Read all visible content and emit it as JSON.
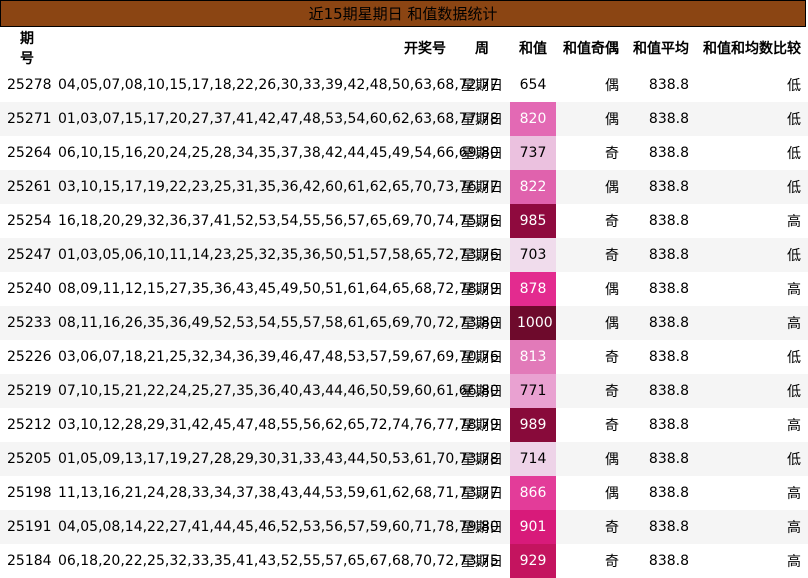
{
  "title": "近15期星期日 和值数据统计",
  "headers": {
    "issue": "期号",
    "numbers": "开奖号",
    "weekday": "周",
    "sum": "和值",
    "sum_oe": "和值奇偶",
    "sum_avg": "和值平均",
    "sum_cmp": "和值和均数比较"
  },
  "rows": [
    {
      "issue": "25278",
      "numbers": "04,05,07,08,10,15,17,18,22,26,30,33,39,42,48,50,63,68,72,77",
      "weekday": "星期日",
      "sum": "654",
      "oe": "偶",
      "avg": "838.8",
      "cmp": "低",
      "color": "#ffffff",
      "textColor": "#000000"
    },
    {
      "issue": "25271",
      "numbers": "01,03,07,15,17,20,27,37,41,42,47,48,53,54,60,62,63,68,77,78",
      "weekday": "星期日",
      "sum": "820",
      "oe": "偶",
      "avg": "838.8",
      "cmp": "低",
      "color": "#e369b4",
      "textColor": "#ffffff"
    },
    {
      "issue": "25264",
      "numbers": "06,10,15,16,20,24,25,28,34,35,37,38,42,44,45,49,54,66,69,80",
      "weekday": "星期日",
      "sum": "737",
      "oe": "奇",
      "avg": "838.8",
      "cmp": "低",
      "color": "#ebc1df",
      "textColor": "#000000"
    },
    {
      "issue": "25261",
      "numbers": "03,10,15,17,19,22,23,25,31,35,36,42,60,61,62,65,70,73,76,77",
      "weekday": "星期日",
      "sum": "822",
      "oe": "偶",
      "avg": "838.8",
      "cmp": "低",
      "color": "#e062ad",
      "textColor": "#ffffff"
    },
    {
      "issue": "25254",
      "numbers": "16,18,20,29,32,36,37,41,52,53,54,55,56,57,65,69,70,74,75,76",
      "weekday": "星期日",
      "sum": "985",
      "oe": "奇",
      "avg": "838.8",
      "cmp": "高",
      "color": "#8f0a3e",
      "textColor": "#ffffff"
    },
    {
      "issue": "25247",
      "numbers": "01,03,05,06,10,11,14,23,25,32,35,36,50,51,57,58,65,72,73,76",
      "weekday": "星期日",
      "sum": "703",
      "oe": "奇",
      "avg": "838.8",
      "cmp": "低",
      "color": "#f0dcec",
      "textColor": "#000000"
    },
    {
      "issue": "25240",
      "numbers": "08,09,11,12,15,27,35,36,43,45,49,50,51,61,64,65,68,72,78,79",
      "weekday": "星期日",
      "sum": "878",
      "oe": "偶",
      "avg": "838.8",
      "cmp": "高",
      "color": "#e32b8f",
      "textColor": "#ffffff"
    },
    {
      "issue": "25233",
      "numbers": "08,11,16,26,35,36,49,52,53,54,55,57,58,61,65,69,70,72,73,80",
      "weekday": "星期日",
      "sum": "1000",
      "oe": "偶",
      "avg": "838.8",
      "cmp": "高",
      "color": "#6e0a2c",
      "textColor": "#ffffff"
    },
    {
      "issue": "25226",
      "numbers": "03,06,07,18,21,25,32,34,36,39,46,47,48,53,57,59,67,69,70,76",
      "weekday": "星期日",
      "sum": "813",
      "oe": "奇",
      "avg": "838.8",
      "cmp": "低",
      "color": "#e27ab9",
      "textColor": "#ffffff"
    },
    {
      "issue": "25219",
      "numbers": "07,10,15,21,22,24,25,27,35,36,40,43,44,46,50,59,60,61,66,80",
      "weekday": "星期日",
      "sum": "771",
      "oe": "奇",
      "avg": "838.8",
      "cmp": "低",
      "color": "#e9a1d1",
      "textColor": "#000000"
    },
    {
      "issue": "25212",
      "numbers": "03,10,12,28,29,31,42,45,47,48,55,56,62,65,72,74,76,77,78,79",
      "weekday": "星期日",
      "sum": "989",
      "oe": "奇",
      "avg": "838.8",
      "cmp": "高",
      "color": "#880a3a",
      "textColor": "#ffffff"
    },
    {
      "issue": "25205",
      "numbers": "01,05,09,13,17,19,27,28,29,30,31,33,43,44,50,53,61,70,73,78",
      "weekday": "星期日",
      "sum": "714",
      "oe": "偶",
      "avg": "838.8",
      "cmp": "低",
      "color": "#eed3e8",
      "textColor": "#000000"
    },
    {
      "issue": "25198",
      "numbers": "11,13,16,21,24,28,33,34,37,38,43,44,53,59,61,62,68,71,73,77",
      "weekday": "星期日",
      "sum": "866",
      "oe": "偶",
      "avg": "838.8",
      "cmp": "高",
      "color": "#e33c99",
      "textColor": "#ffffff"
    },
    {
      "issue": "25191",
      "numbers": "04,05,08,14,22,27,41,44,45,46,52,53,56,57,59,60,71,78,79,80",
      "weekday": "星期日",
      "sum": "901",
      "oe": "奇",
      "avg": "838.8",
      "cmp": "高",
      "color": "#d81a7a",
      "textColor": "#ffffff"
    },
    {
      "issue": "25184",
      "numbers": "06,18,20,22,25,32,33,35,41,43,52,55,57,65,67,68,70,72,73,75",
      "weekday": "星期日",
      "sum": "929",
      "oe": "奇",
      "avg": "838.8",
      "cmp": "高",
      "color": "#c4145f",
      "textColor": "#ffffff"
    }
  ]
}
